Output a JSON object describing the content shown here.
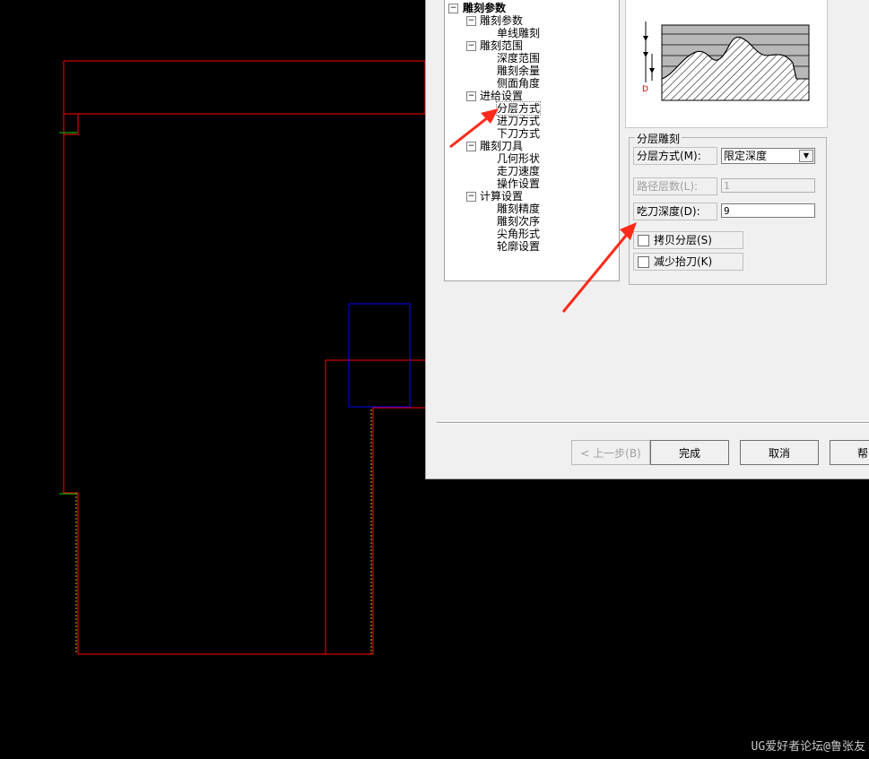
{
  "tree": {
    "root": "雕刻参数",
    "groups": [
      {
        "label": "雕刻参数",
        "children": [
          "单线雕刻"
        ]
      },
      {
        "label": "雕刻范围",
        "children": [
          "深度范围",
          "雕刻余量",
          "侧面角度"
        ]
      },
      {
        "label": "进给设置",
        "children": [
          "分层方式",
          "进刀方式",
          "下刀方式"
        ]
      },
      {
        "label": "雕刻刀具",
        "children": [
          "几何形状",
          "走刀速度",
          "操作设置"
        ]
      },
      {
        "label": "计算设置",
        "children": [
          "雕刻精度",
          "雕刻次序",
          "尖角形式",
          "轮廓设置"
        ]
      }
    ],
    "selected": "分层方式"
  },
  "preview": {
    "label": "D"
  },
  "layer_group": {
    "title": "分层雕刻",
    "method_label": "分层方式(M):",
    "method_value": "限定深度",
    "path_layers_label": "路径层数(L):",
    "path_layers_value": "1",
    "cut_depth_label": "吃刀深度(D):",
    "cut_depth_value": "9",
    "copy_layers_label": "拷贝分层(S)",
    "copy_layers_checked": false,
    "reduce_lift_label": "减少抬刀(K)",
    "reduce_lift_checked": false
  },
  "buttons": {
    "back": "< 上一步(B)",
    "finish": "完成",
    "cancel": "取消",
    "help": "帮"
  },
  "colors": {
    "outline": "#ff0000",
    "tool": "#0000ff",
    "annotation_arrow": "#ff2a1a"
  },
  "watermark": "UG爱好者论坛@鲁张友"
}
